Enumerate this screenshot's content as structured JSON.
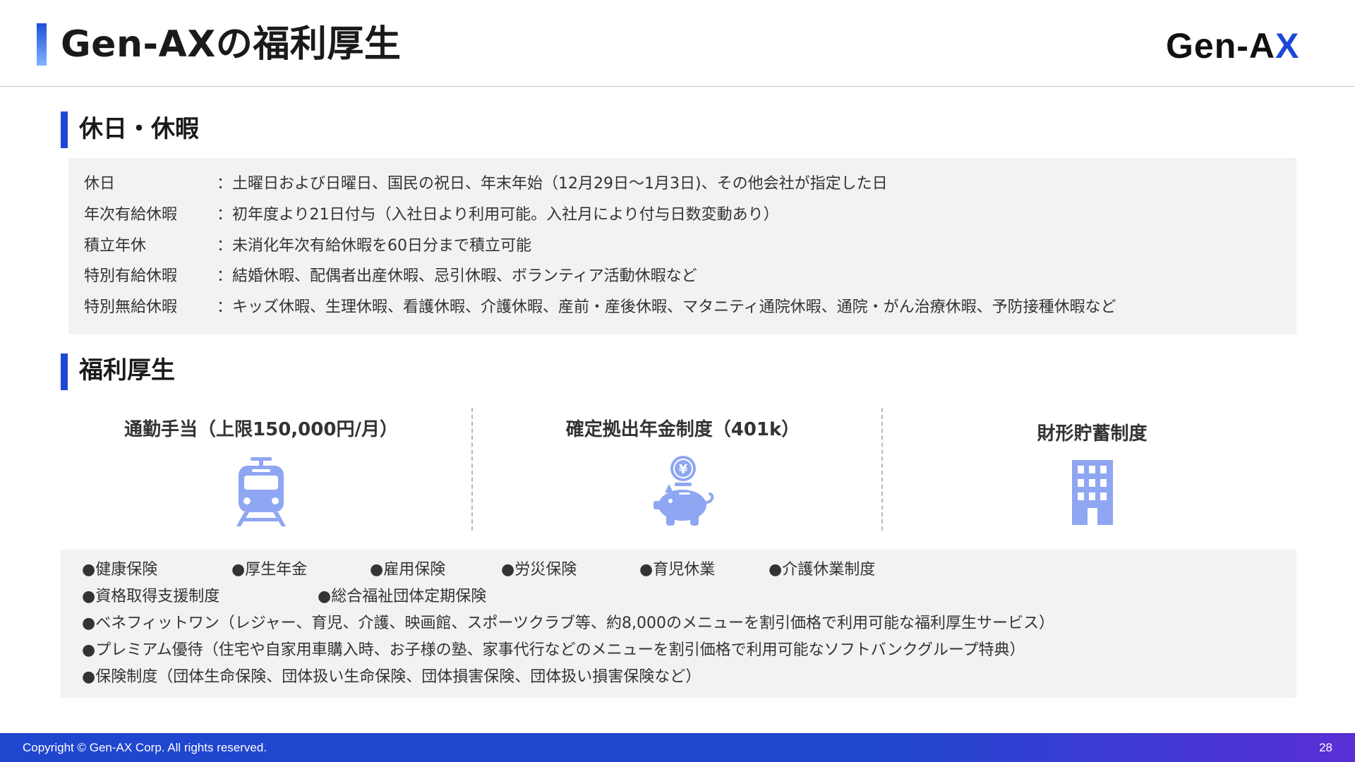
{
  "header": {
    "title": "Gen-AXの福利厚生",
    "logo_main": "Gen-A",
    "logo_accent": "X"
  },
  "holiday_section": {
    "title": "休日・休暇",
    "rows": [
      {
        "label": "休日",
        "value": "：土曜日および日曜日、国民の祝日、年末年始（12月29日～1月3日)、その他会社が指定した日"
      },
      {
        "label": "年次有給休暇",
        "value": "：初年度より21日付与（入社日より利用可能。入社月により付与日数変動あり）"
      },
      {
        "label": "積立年休",
        "value": "：未消化年次有給休暇を60日分まで積立可能"
      },
      {
        "label": "特別有給休暇",
        "value": "：結婚休暇、配偶者出産休暇、忌引休暇、ボランティア活動休暇など"
      },
      {
        "label": "特別無給休暇",
        "value": "：キッズ休暇、生理休暇、看護休暇、介護休暇、産前・産後休暇、マタニティ通院休暇、通院・がん治療休暇、予防接種休暇など"
      }
    ]
  },
  "welfare_section": {
    "title": "福利厚生",
    "columns": [
      {
        "title": "通勤手当（上限150,000円/月）",
        "icon": "train-icon"
      },
      {
        "title": "確定拠出年金制度（401k）",
        "icon": "piggy-bank-icon"
      },
      {
        "title": "財形貯蓄制度",
        "icon": "building-icon"
      }
    ],
    "row1": [
      "●健康保険",
      "●厚生年金",
      "●雇用保険",
      "●労災保険",
      "●育児休業",
      "●介護休業制度"
    ],
    "row2": [
      "●資格取得支援制度",
      "●総合福祉団体定期保険"
    ],
    "row3": "●ベネフィットワン（レジャー、育児、介護、映画館、スポーツクラブ等、約8,000のメニューを割引価格で利用可能な福利厚生サービス）",
    "row4": "●プレミアム優待（住宅や自家用車購入時、お子様の塾、家事代行などのメニューを割引価格で利用可能なソフトバンクグループ特典）",
    "row5": "●保険制度（団体生命保険、団体扱い生命保険、団体損害保険、団体扱い損害保険など）"
  },
  "footer": {
    "copyright": "Copyright © Gen-AX Corp. All rights reserved.",
    "page_number": "28"
  },
  "colors": {
    "accent": "#1d47d6",
    "icon": "#8fa6f2",
    "panel": "#f2f2f2"
  }
}
